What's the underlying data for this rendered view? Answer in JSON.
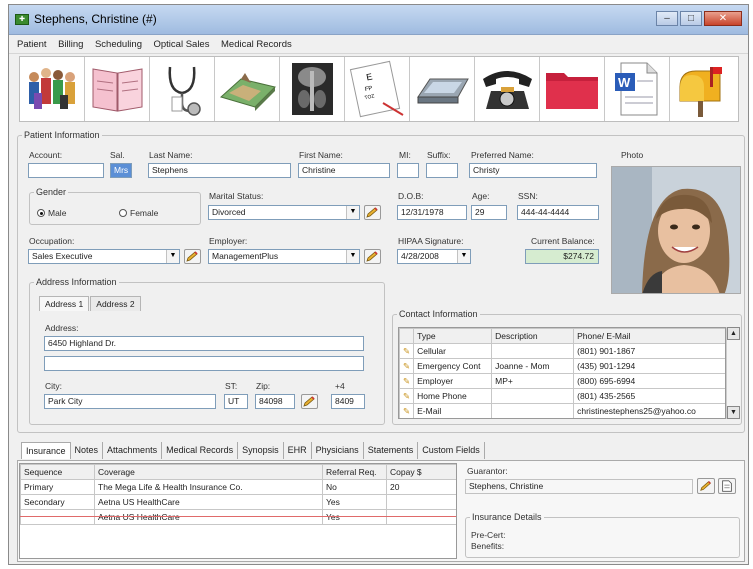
{
  "window": {
    "title": "Stephens, Christine (#)"
  },
  "menu": [
    "Patient",
    "Billing",
    "Scheduling",
    "Optical Sales",
    "Medical Records"
  ],
  "toolbar": {
    "icons": [
      "people-icon",
      "book-icon",
      "stethoscope-icon",
      "map-icon",
      "xray-icon",
      "eye-chart-icon",
      "scanner-icon",
      "telephone-icon",
      "folder-icon",
      "word-document-icon",
      "mailbox-icon"
    ]
  },
  "patient": {
    "legend": "Patient Information",
    "account_label": "Account:",
    "account": "",
    "sal_label": "Sal.",
    "sal": "Mrs",
    "last_label": "Last Name:",
    "last": "Stephens",
    "first_label": "First Name:",
    "first": "Christine",
    "mi_label": "MI:",
    "mi": "",
    "suffix_label": "Suffix:",
    "suffix": "",
    "pref_label": "Preferred Name:",
    "pref": "Christy",
    "photo_label": "Photo",
    "gender_legend": "Gender",
    "gender_male": "Male",
    "gender_female": "Female",
    "marital_label": "Marital Status:",
    "marital": "Divorced",
    "dob_label": "D.O.B:",
    "dob": "12/31/1978",
    "age_label": "Age:",
    "age": "29",
    "ssn_label": "SSN:",
    "ssn": "444-44-4444",
    "occupation_label": "Occupation:",
    "occupation": "Sales Executive",
    "employer_label": "Employer:",
    "employer": "ManagementPlus",
    "hipaa_label": "HIPAA Signature:",
    "hipaa": "4/28/2008",
    "balance_label": "Current Balance:",
    "balance": "$274.72"
  },
  "address": {
    "legend": "Address Information",
    "tab1": "Address 1",
    "tab2": "Address 2",
    "address_label": "Address:",
    "line1": "6450 Highland Dr.",
    "line2": "",
    "city_label": "City:",
    "city": "Park City",
    "st_label": "ST:",
    "st": "UT",
    "zip_label": "Zip:",
    "zip": "84098",
    "plus4_label": "+4",
    "plus4": "8409"
  },
  "contact": {
    "legend": "Contact Information",
    "headers": [
      "Type",
      "Description",
      "Phone/ E-Mail"
    ],
    "rows": [
      {
        "type": "Cellular",
        "desc": "",
        "phone": "(801) 901-1867"
      },
      {
        "type": "Emergency Cont",
        "desc": "Joanne - Mom",
        "phone": "(435) 901-1294"
      },
      {
        "type": "Employer",
        "desc": "MP+",
        "phone": "(800) 695-6994"
      },
      {
        "type": "Home Phone",
        "desc": "",
        "phone": "(801) 435-2565"
      },
      {
        "type": "E-Mail",
        "desc": "",
        "phone": "christinestephens25@yahoo.co"
      }
    ]
  },
  "tabs": [
    "Insurance",
    "Notes",
    "Attachments",
    "Medical Records",
    "Synopsis",
    "EHR",
    "Physicians",
    "Statements",
    "Custom Fields"
  ],
  "insurance": {
    "headers": [
      "Sequence",
      "Coverage",
      "Referral Req.",
      "Copay $"
    ],
    "rows": [
      {
        "sequence": "Primary",
        "coverage": "The Mega Life & Health Insurance Co.",
        "referral": "No",
        "copay": "20"
      },
      {
        "sequence": "Secondary",
        "coverage": "Aetna US HealthCare",
        "referral": "Yes",
        "copay": ""
      },
      {
        "sequence": "",
        "coverage": "Aetna US HealthCare",
        "referral": "Yes",
        "copay": ""
      }
    ],
    "guarantor_label": "Guarantor:",
    "guarantor": "Stephens, Christine",
    "details_legend": "Insurance Details",
    "precert": "Pre-Cert:",
    "benefits": "Benefits:"
  }
}
